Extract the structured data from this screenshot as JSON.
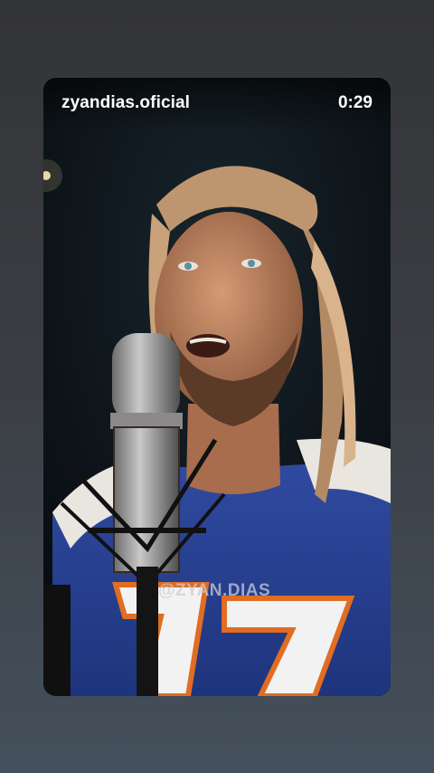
{
  "video": {
    "account_name": "zyandias.oficial",
    "time_remaining": "0:29",
    "watermark": "@ZYAN.DIAS",
    "jersey_number": "17"
  },
  "colors": {
    "jersey_blue": "#27408f",
    "jersey_orange": "#e06d22"
  }
}
